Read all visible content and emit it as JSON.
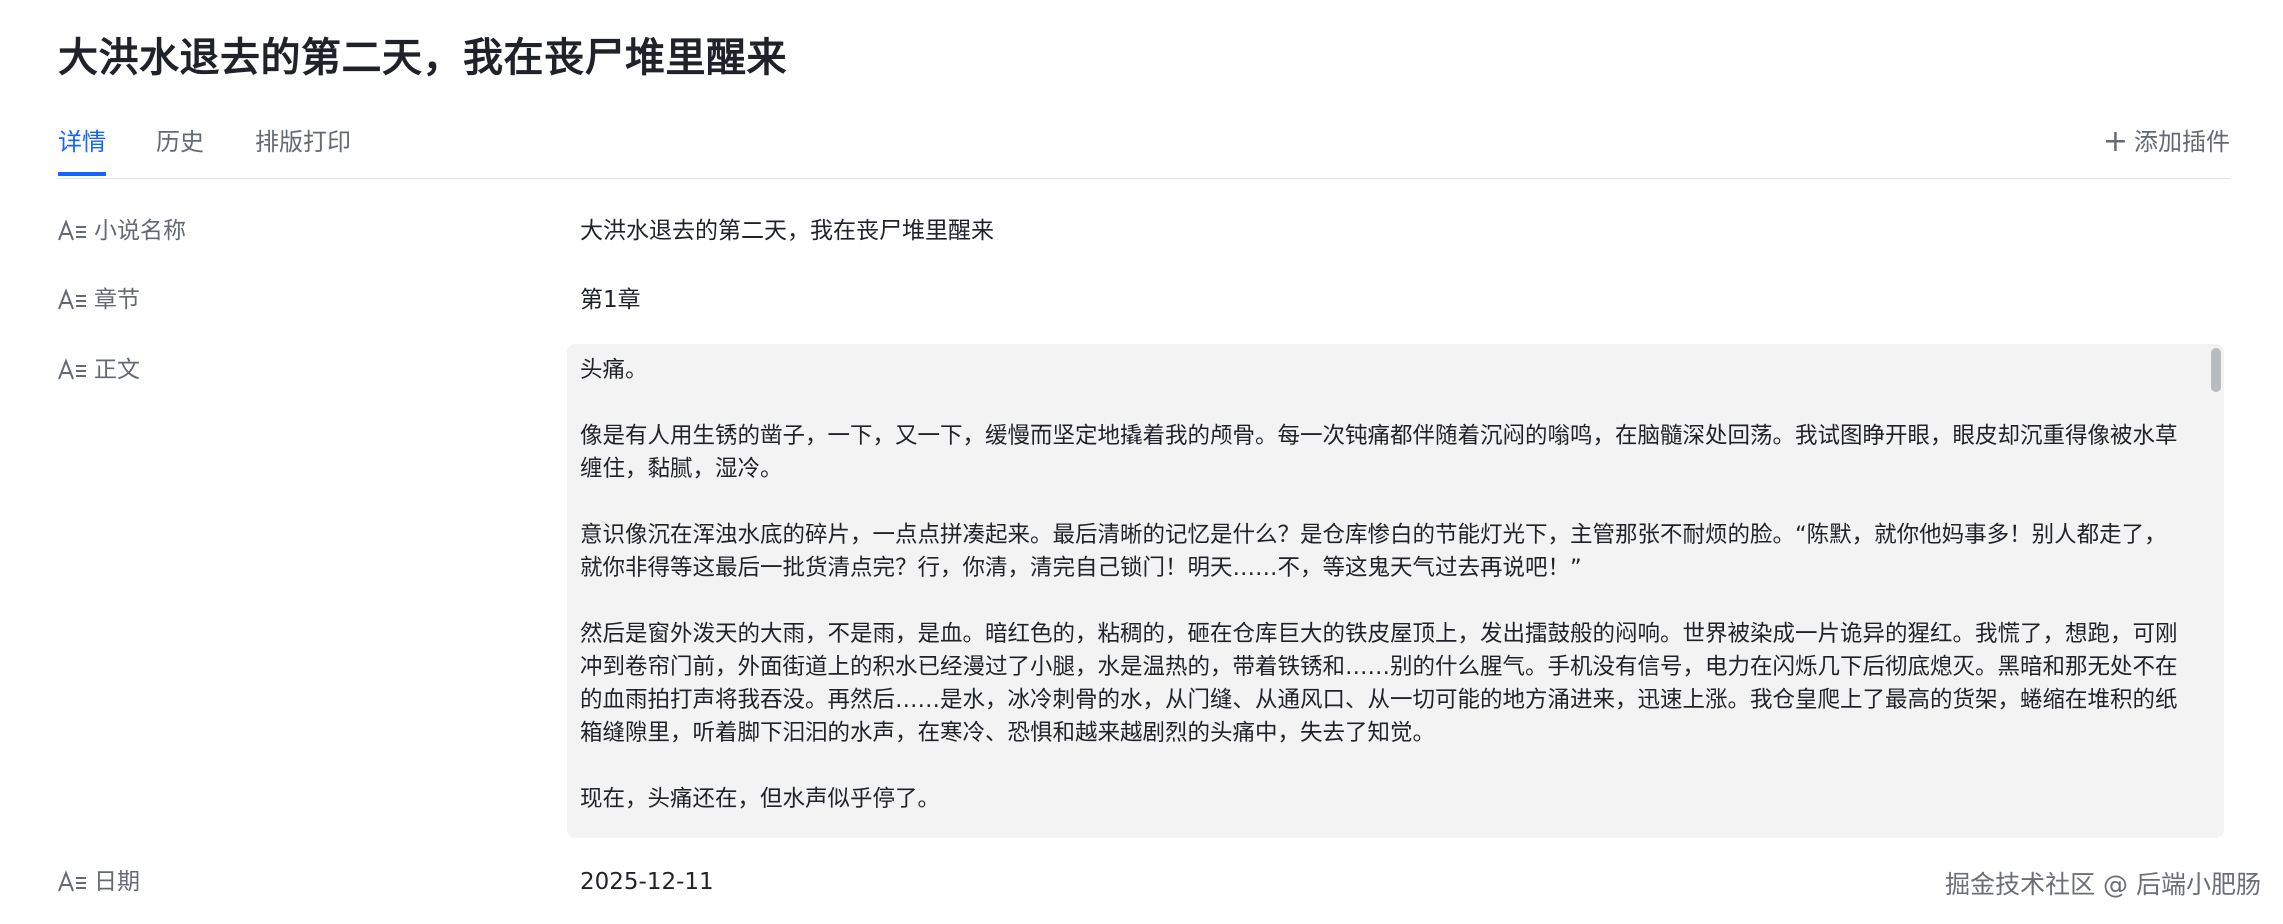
{
  "page": {
    "title": "大洪水退去的第二天，我在丧尸堆里醒来"
  },
  "tabs": [
    {
      "label": "详情",
      "active": true
    },
    {
      "label": "历史",
      "active": false
    },
    {
      "label": "排版打印",
      "active": false
    }
  ],
  "toolbar": {
    "add_plugin_label": "添加插件",
    "add_plugin_icon": "plus-icon"
  },
  "fields": {
    "icon": "text-field-icon",
    "novel_name": {
      "label": "小说名称",
      "value": "大洪水退去的第二天，我在丧尸堆里醒来"
    },
    "chapter": {
      "label": "章节",
      "value": "第1章"
    },
    "body": {
      "label": "正文",
      "paragraphs": [
        "头痛。",
        "像是有人用生锈的凿子，一下，又一下，缓慢而坚定地撬着我的颅骨。每一次钝痛都伴随着沉闷的嗡鸣，在脑髓深处回荡。我试图睁开眼，眼皮却沉重得像被水草缠住，黏腻，湿冷。",
        "意识像沉在浑浊水底的碎片，一点点拼凑起来。最后清晰的记忆是什么？是仓库惨白的节能灯光下，主管那张不耐烦的脸。“陈默，就你他妈事多！别人都走了，就你非得等这最后一批货清点完？行，你清，清完自己锁门！明天……不，等这鬼天气过去再说吧！”",
        "然后是窗外泼天的大雨，不是雨，是血。暗红色的，粘稠的，砸在仓库巨大的铁皮屋顶上，发出擂鼓般的闷响。世界被染成一片诡异的猩红。我慌了，想跑，可刚冲到卷帘门前，外面街道上的积水已经漫过了小腿，水是温热的，带着铁锈和……别的什么腥气。手机没有信号，电力在闪烁几下后彻底熄灭。黑暗和那无处不在的血雨拍打声将我吞没。再然后……是水，冰冷刺骨的水，从门缝、从通风口、从一切可能的地方涌进来，迅速上涨。我仓皇爬上了最高的货架，蜷缩在堆积的纸箱缝隙里，听着脚下汩汩的水声，在寒冷、恐惧和越来越剧烈的头痛中，失去了知觉。",
        "现在，头痛还在，但水声似乎停了。"
      ]
    },
    "date": {
      "label": "日期",
      "value": "2025-12-11"
    }
  },
  "watermark": {
    "text": "掘金技术社区 @ 后端小肥肠"
  },
  "colors": {
    "accent": "#1664ff",
    "text_primary": "#1f2329",
    "text_secondary": "#646a73",
    "body_background": "#f3f3f3"
  }
}
